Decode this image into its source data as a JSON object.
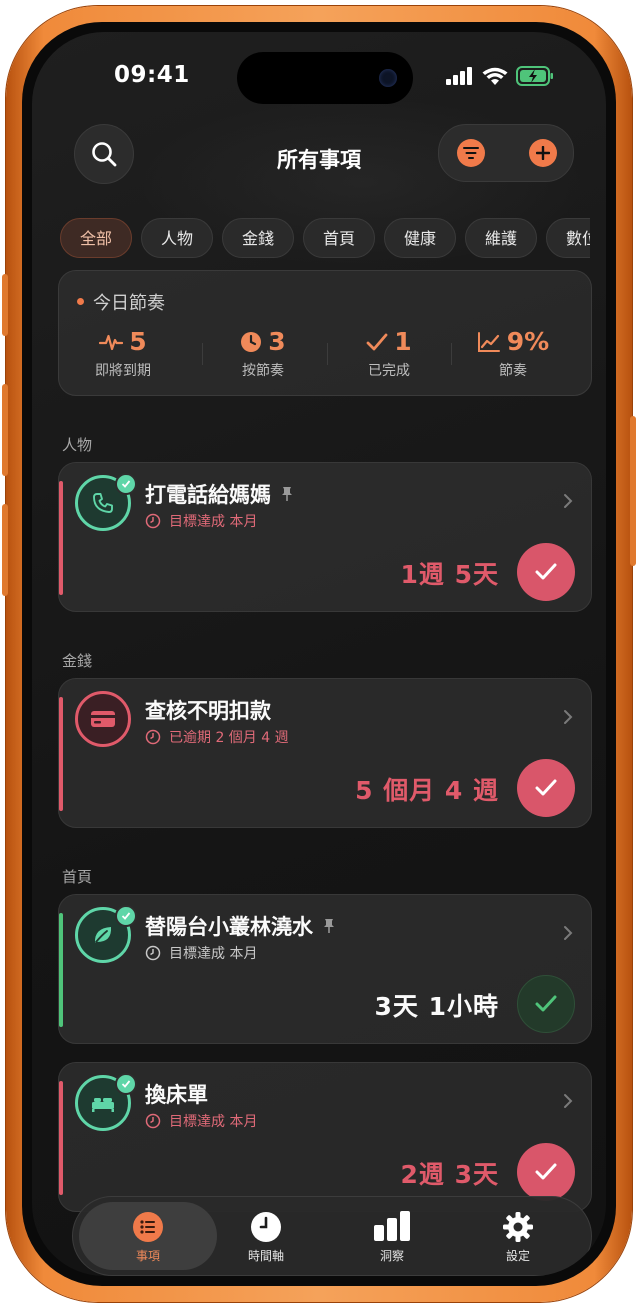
{
  "status_bar": {
    "time": "09:41"
  },
  "header": {
    "title": "所有事項"
  },
  "chips": [
    "全部",
    "人物",
    "金錢",
    "首頁",
    "健康",
    "維護",
    "數位"
  ],
  "rhythm": {
    "title": "今日節奏",
    "stats": [
      {
        "value": "5",
        "label": "即將到期",
        "icon": "pulse-icon"
      },
      {
        "value": "3",
        "label": "按節奏",
        "icon": "clock-icon"
      },
      {
        "value": "1",
        "label": "已完成",
        "icon": "check-icon"
      },
      {
        "value": "9%",
        "label": "節奏",
        "icon": "trend-icon"
      }
    ]
  },
  "sections": [
    {
      "label": "人物"
    },
    {
      "label": "金錢"
    },
    {
      "label": "首頁"
    }
  ],
  "cards": [
    {
      "name": "打電話給媽媽",
      "pinned": true,
      "subtitle": "目標達成 本月",
      "due": "1週 5天",
      "icon": "phone-icon",
      "status": "due"
    },
    {
      "name": "查核不明扣款",
      "pinned": false,
      "subtitle": "已逾期 2 個月 4 週",
      "due": "5 個月 4 週",
      "icon": "credit-card-icon",
      "status": "overdue"
    },
    {
      "name": "替陽台小叢林澆水",
      "pinned": true,
      "subtitle": "目標達成 本月",
      "due": "3天 1小時",
      "icon": "leaf-icon",
      "status": "on-track"
    },
    {
      "name": "換床單",
      "pinned": false,
      "subtitle": "目標達成 本月",
      "due": "2週 3天",
      "icon": "bed-icon",
      "status": "due"
    }
  ],
  "tabs": [
    {
      "label": "事項",
      "icon": "list-icon"
    },
    {
      "label": "時間軸",
      "icon": "clock-icon"
    },
    {
      "label": "洞察",
      "icon": "bar-chart-icon"
    },
    {
      "label": "設定",
      "icon": "gear-icon"
    }
  ],
  "colors": {
    "accent": "#f07a4a",
    "overdue": "#e05a6a",
    "on_track": "#4fc47a",
    "ring": "#5fd6a8"
  }
}
